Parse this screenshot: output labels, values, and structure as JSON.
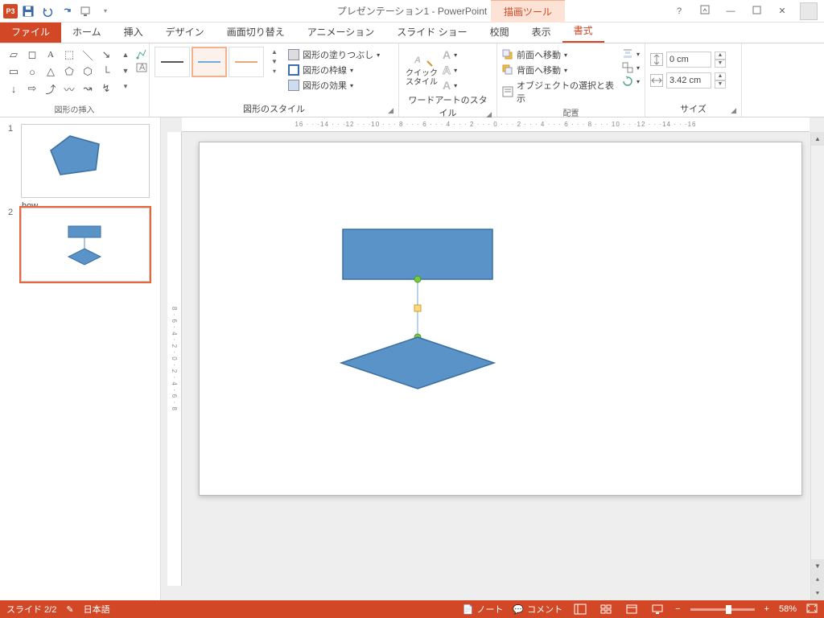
{
  "app": {
    "title": "プレゼンテーション1 - PowerPoint",
    "drawing_tools": "描画ツール",
    "icon": "P3"
  },
  "tabs": {
    "file": "ファイル",
    "items": [
      "ホーム",
      "挿入",
      "デザイン",
      "画面切り替え",
      "アニメーション",
      "スライド ショー",
      "校閲",
      "表示",
      "書式"
    ],
    "active": "書式"
  },
  "ribbon": {
    "insert_shapes": "図形の挿入",
    "shape_styles": "図形のスタイル",
    "fill": "図形の塗りつぶし",
    "outline": "図形の枠線",
    "effects": "図形の効果",
    "quick_styles": "クイック スタイル",
    "wordart_styles": "ワードアートのスタイル",
    "bring_forward": "前面へ移動",
    "send_backward": "背面へ移動",
    "selection_pane": "オブジェクトの選択と表示",
    "arrange": "配置",
    "size": "サイズ",
    "height": "0 cm",
    "width": "3.42 cm"
  },
  "ruler": "16 · · ·14 · · ·12 · · ·10 · · · 8 · · · 6 · · · 4 · · · 2 · · · 0 · · · 2 · · · 4 · · · 6 · · · 8 · · · 10 · · ·12 · · ·14 · · ·16",
  "ruler_v": "8 · 6 · 4 · 2 · 0 · 2 · 4 · 6 · 8",
  "thumbs": {
    "1": "1",
    "2": "2"
  },
  "status": {
    "slide": "スライド 2/2",
    "lang": "日本語",
    "notes": "ノート",
    "comments": "コメント",
    "zoom": "58%"
  }
}
